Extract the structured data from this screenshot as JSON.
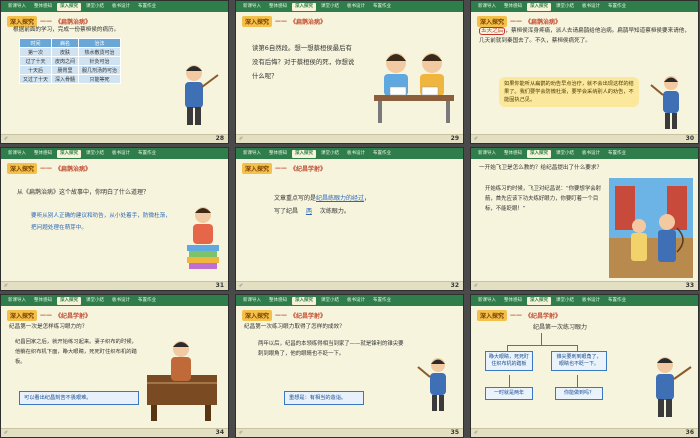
{
  "nav": {
    "tabs": [
      "新课导入",
      "整体感知",
      "深入探究",
      "课堂小结",
      "板书设计",
      "布置作业"
    ]
  },
  "section": {
    "badge": "深入探究",
    "dash": "——",
    "s1": "《扁鹊治病》",
    "s2": "《纪昌学射》"
  },
  "slides": {
    "s28": {
      "page": "28",
      "intro": "根据前面的学习，完成一份蔡桓侯的病历。",
      "table": [
        [
          "时间",
          "病名",
          "治法"
        ],
        [
          "第一次",
          "皮肤",
          "热水敷烫可治"
        ],
        [
          "过了十天",
          "皮肉之间",
          "针灸可治"
        ],
        [
          "十天后",
          "肠胃里",
          "服几剂汤药可治"
        ],
        [
          "又过了十天",
          "深入骨髓",
          "只能等死"
        ]
      ]
    },
    "s29": {
      "page": "29",
      "q": "读第6自然段。想一想蔡桓侯最后有没有后悔？对于蔡桓侯的死，你想说什么呢？"
    },
    "s30": {
      "page": "30",
      "tag": "五天之后",
      "text": "，蔡桓侯浑身疼痛，派人去请扁鹊给他治病。扁鹊早知道蔡桓侯要来请他，几天前就到秦国去了。不久，蔡桓侯病死了。",
      "box": "如果你能听从扁鹊的劝告早点治疗，就不会出现这样的结果了。我们要学会防微杜渐，要学会采纳别人的劝告，不能固执己见。"
    },
    "s31": {
      "page": "31",
      "q": "从《扁鹊治病》这个故事中，你明白了什么道理？",
      "a": "要听从别人正确的建议和劝告，从小处着手，防微杜渐，把问题处理在萌芽中。"
    },
    "s32": {
      "page": "32",
      "l1a": "文章重点写的是",
      "l1b": "纪昌练眼力的经过",
      "l1c": "，",
      "l2a": "写了纪昌",
      "l2b": "两",
      "l2c": "次练眼力。"
    },
    "s33": {
      "page": "33",
      "q": "一开始飞卫是怎么教的？给纪昌提出了什么要求？",
      "quote": "开始练习的时候，飞卫对纪昌说：“你要想学会射箭，首先应该下功夫练好眼力，你要盯着一个目标，不能眨眼！”"
    },
    "s34": {
      "page": "34",
      "q": "纪昌第一次是怎样练习眼力的？",
      "p": "纪昌回家之后，就开始练习起来。妻子织布的时候，他躺在织布机下面，睁大眼睛，死死盯住织布机的踏板。",
      "box": "可以看出纪昌刻苦不畏艰难。"
    },
    "s35": {
      "page": "35",
      "q": "纪昌第一次练习眼力取得了怎样的成效？",
      "p": "两年以后，纪昌的本领练得相当到家了——就是锋利的锥尖要刺到眼角了，他的眼睛也不眨一下。",
      "box": "重想是：有相当的造诣。"
    },
    "s36": {
      "page": "36",
      "title": "纪昌第一次练习眼力",
      "b1": "睁大眼睛，死死盯住织布机的踏板",
      "b2": "锥尖要刺到眼角了，眼睛也不眨一下。",
      "b3": "一时就是两年",
      "b4": "你能做到吗？"
    }
  }
}
